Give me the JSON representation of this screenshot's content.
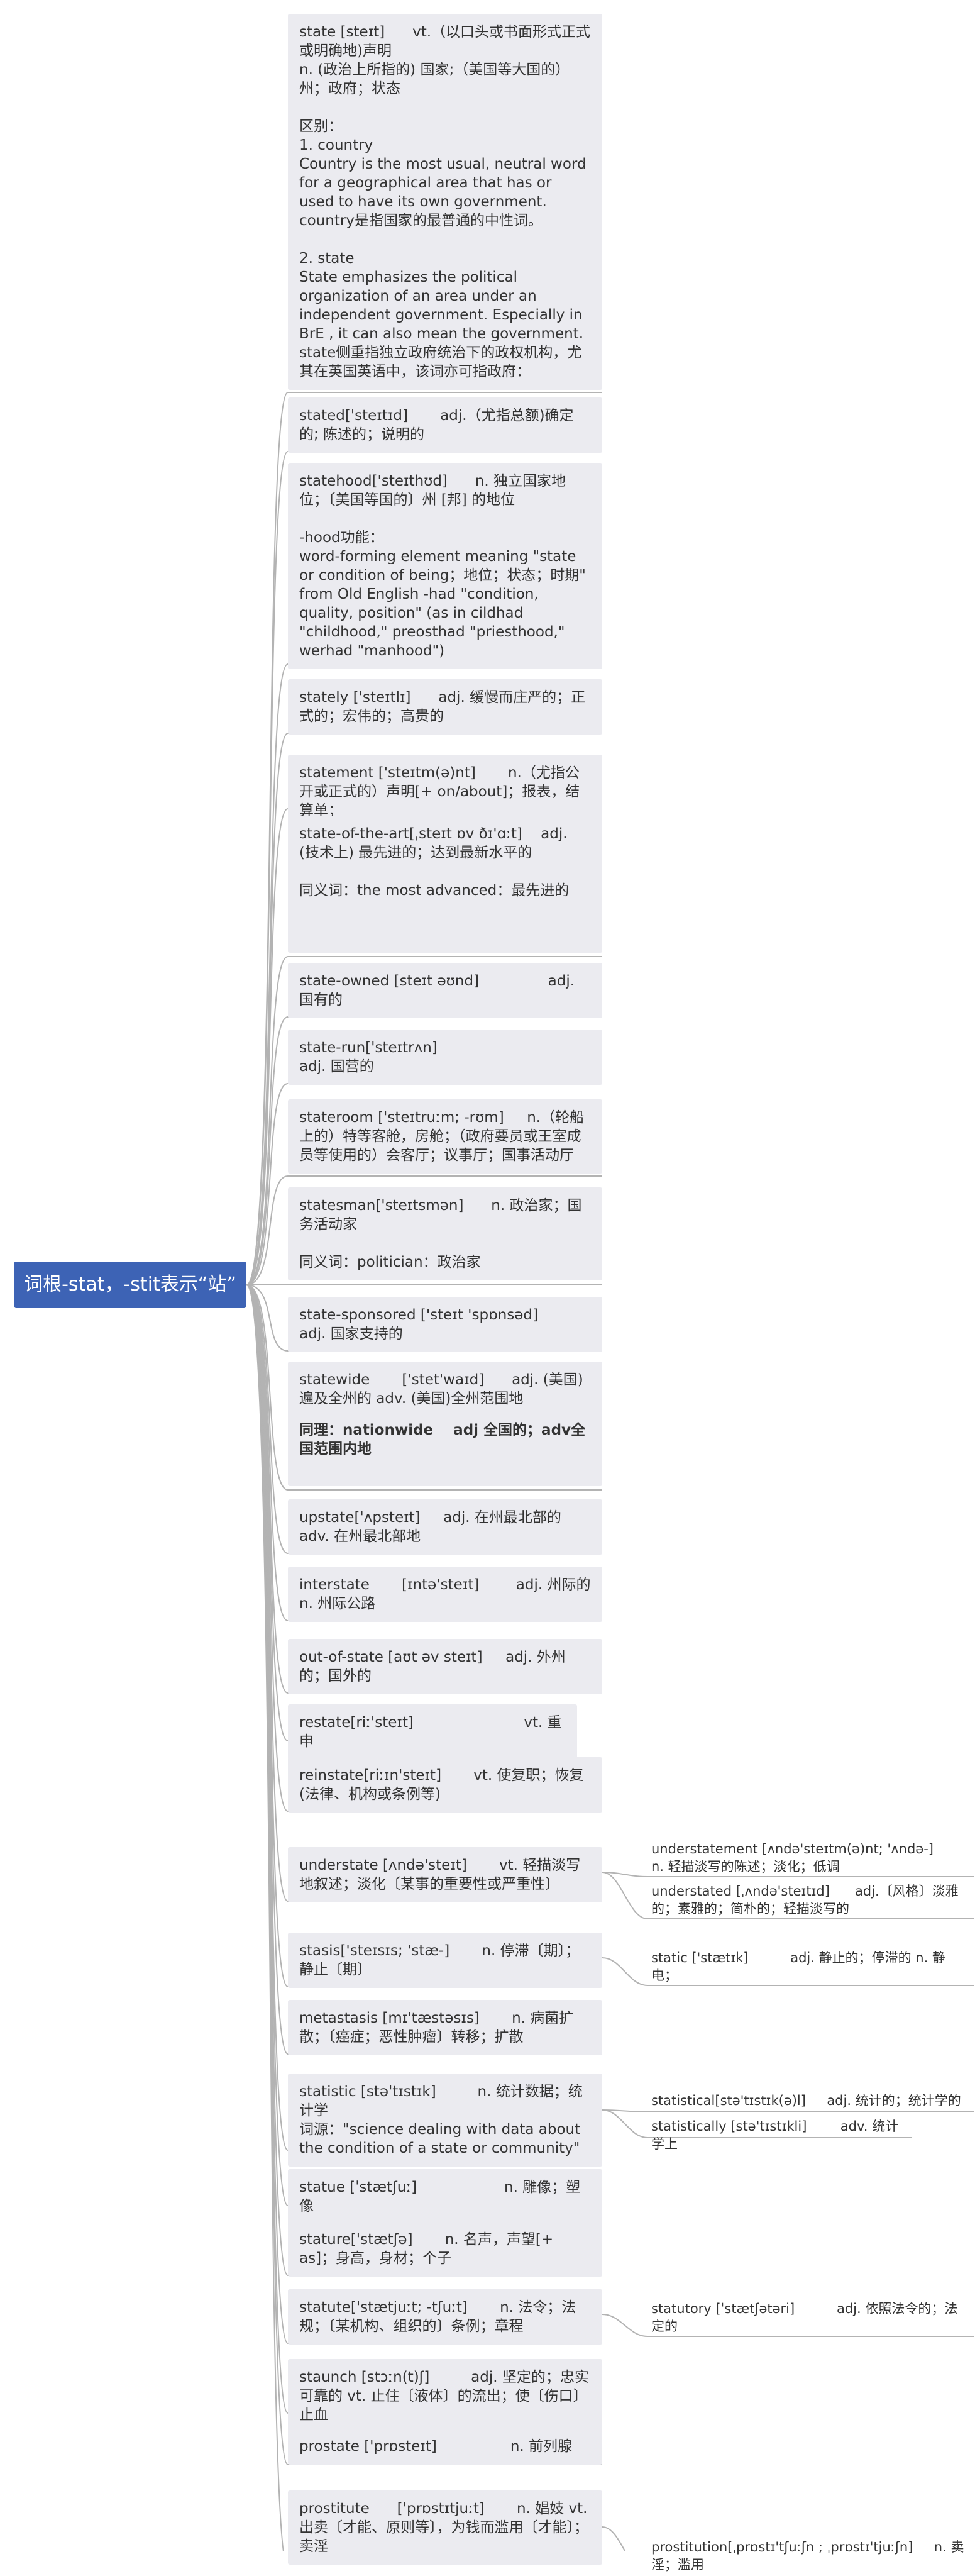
{
  "root": {
    "label": "词根-stat，-stit表示“站”"
  },
  "nodes": [
    {
      "id": "state",
      "text": "state [steɪt]      vt.（以口头或书面形式正式或明确地)声明\nn. (政治上所指的) 国家;（美国等大国的）州；政府；状态\n\n区别：\n1. country\nCountry is the most usual, neutral word for a geographical area that has or used to have its own government. country是指国家的最普通的中性词。\n\n2. state\nState emphasizes the political organization of an area under an independent government. Especially in BrE , it can also mean the government. state侧重指独立政府统治下的政权机构，尤其在英国英语中，该词亦可指政府："
    },
    {
      "id": "stated",
      "text": "stated['steɪtɪd]       adj.（尤指总额)确定的; 陈述的；说明的"
    },
    {
      "id": "statehood",
      "text": "statehood['steɪthʊd]      n. 独立国家地位；〔美国等国的〕州 [邦] 的地位\n\n-hood功能：\nword-forming element meaning \"state or condition of being；地位；状态；时期\" from Old English -had \"condition, quality, position\" (as in cildhad \"childhood,\" preosthad \"priesthood,\" werhad \"manhood\")"
    },
    {
      "id": "stately",
      "text": "stately ['steɪtlɪ]      adj. 缓慢而庄严的；正式的；宏伟的；高贵的"
    },
    {
      "id": "statement",
      "text": "statement ['steɪtm(ə)nt]       n.（尤指公开或正式的）声明[+ on/about]；报表，结算单；"
    },
    {
      "id": "stateoftheart",
      "text": "state-of-the-art[ˌsteɪt ɒv ðɪ'ɑːt]    adj. (技术上) 最先进的；达到最新水平的\n\n同义词：the most advanced：最先进的"
    },
    {
      "id": "stateowned",
      "text": "state-owned [steɪt əʊnd]               adj. 国有的"
    },
    {
      "id": "staterun",
      "text": "state-run['steɪtrʌn]                              adj. 国营的"
    },
    {
      "id": "stateroom",
      "text": "stateroom ['steɪtruːm; -rʊm]     n.（轮船上的）特等客舱，房舱；（政府要员或王室成员等使用的）会客厅；议事厅；国事活动厅"
    },
    {
      "id": "statesman",
      "text": "statesman['steɪtsmən]      n. 政治家；国务活动家\n\n同义词：politician：政治家"
    },
    {
      "id": "statesponsored",
      "text": "state-sponsored ['steɪt 'spɒnsəd]        adj. 国家支持的"
    },
    {
      "id": "statewide",
      "text": "statewide       ['stet'waɪd]      adj. (美国)遍及全州的 adv. (美国)全州范围地",
      "bold": "同理：nationwide    adj 全国的；adv全国范围内地"
    },
    {
      "id": "upstate",
      "text": "upstate['ʌpsteɪt]     adj. 在州最北部的 adv. 在州最北部地"
    },
    {
      "id": "interstate",
      "text": "interstate       [ɪntə'steɪt]        adj. 州际的 n. 州际公路"
    },
    {
      "id": "outofstate",
      "text": "out-of-state [aʊt əv steɪt]     adj. 外州的；国外的"
    },
    {
      "id": "restate",
      "text": "restate[riː'steɪt]                        vt. 重申"
    },
    {
      "id": "reinstate",
      "text": "reinstate[riːɪn'steɪt]       vt. 使复职；恢复 (法律、机构或条例等)"
    },
    {
      "id": "understate",
      "text": "understate [ʌndə'steɪt]       vt. 轻描淡写地叙述；淡化〔某事的重要性或严重性〕"
    },
    {
      "id": "stasis",
      "text": "stasis['steɪsɪs; 'stæ-]       n. 停滞〔期〕；静止〔期〕"
    },
    {
      "id": "metastasis",
      "text": "metastasis [mɪ'tæstəsɪs]       n. 病菌扩散；〔癌症；恶性肿瘤〕转移；扩散"
    },
    {
      "id": "statistic",
      "text": "statistic [stə'tɪstɪk]         n. 统计数据；统计学\n词源：\"science dealing with data about the condition of a state or community\""
    },
    {
      "id": "statue",
      "text": "statue [ˈstætʃuː]                   n. 雕像；塑像"
    },
    {
      "id": "stature",
      "text": "stature['stætʃə]       n. 名声，声望[+ as]；身高，身材；个子"
    },
    {
      "id": "statute",
      "text": "statute['stætjuːt; -tʃuːt]       n. 法令；法规；〔某机构、组织的〕条例；章程"
    },
    {
      "id": "staunch",
      "text": "staunch [stɔːn(t)ʃ]         adj. 坚定的；忠实可靠的 vt. 止住〔液体〕的流出；使〔伤口〕止血"
    },
    {
      "id": "prostate",
      "text": "prostate ['prɒsteɪt]                n. 前列腺"
    },
    {
      "id": "prostitute",
      "text": "prostitute      ['prɒstɪtjuːt]       n. 娼妓 vt. 出卖〔才能、原则等〕，为钱而滥用〔才能〕；卖淫"
    }
  ],
  "subnodes": [
    {
      "id": "understatement",
      "parent": "understate",
      "text": "understatement [ʌndə'steɪtm(ə)nt; 'ʌndə-]       n. 轻描淡写的陈述；淡化；低调"
    },
    {
      "id": "understated",
      "parent": "understate",
      "text": "understated [ˌʌndə'steɪtɪd]      adj.〔风格〕淡雅的；素雅的；简朴的；轻描淡写的"
    },
    {
      "id": "static",
      "parent": "stasis",
      "text": "static ['stætɪk]          adj. 静止的；停滞的 n. 静电；"
    },
    {
      "id": "statistical",
      "parent": "statistic",
      "text": "statistical[stə'tɪstɪk(ə)l]     adj. 统计的；统计学的"
    },
    {
      "id": "statistically",
      "parent": "statistic",
      "text": "statistically [stə'tɪstɪkli]        adv. 统计学上"
    },
    {
      "id": "statutory",
      "parent": "statute",
      "text": "statutory [ˈstætʃətəri]          adj. 依照法令的；法定的"
    },
    {
      "id": "prostitution",
      "parent": "prostitute",
      "text": "prostitution[ˌprɒstɪ'tʃuːʃn ; ˌprɒstɪ'tjuːʃn]     n. 卖淫；滥用"
    }
  ],
  "colors": {
    "root_bg": "#3d63b5",
    "node_bg": "#ebebf0",
    "line": "#b3b3b3"
  }
}
